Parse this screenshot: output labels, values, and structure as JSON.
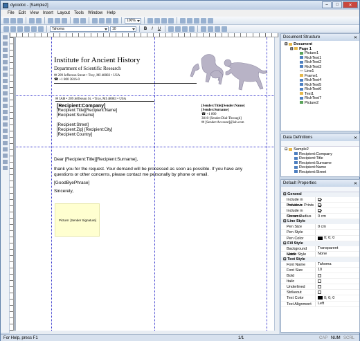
{
  "window": {
    "title": "dycodoc - [Sample2]",
    "close_label": "✕",
    "min_label": "–",
    "max_label": "□"
  },
  "menu": [
    "File",
    "Edit",
    "View",
    "Insert",
    "Layout",
    "Tools",
    "Window",
    "Help"
  ],
  "toolbar": {
    "zoom": "100%",
    "font_name": "Tahoma",
    "font_size": "10",
    "bold": "B",
    "italic": "I",
    "underline": "U"
  },
  "document": {
    "institute_title": "Institute for Ancient History",
    "department": "Department of Scientific Research",
    "address": "209 Jefferson Street • Troy, MI 48083 • USA",
    "phone": "+1 800 3816-0",
    "sender_line": "IAH • 209 Jefferson St. • Troy, MI 48083 • USA",
    "recipient": {
      "company": "[Recipient:Company]",
      "title_name": "[Recipient:Title][Recipient:Name]",
      "surname": "[Recipient:Surname]",
      "street": "[Recipient:Street]",
      "zip_city": "[Recipient:Zip] [Recipient:City]",
      "country": "[Recipient:Country]"
    },
    "sender": {
      "title_name": "[Sender:Title][Sender:Name]",
      "surname": "[Sender:Surname]",
      "phone": "+1 800",
      "dial": "3816-[Sender:Dial-Through]",
      "email": "[Sender:Account]@iah.com"
    },
    "salutation": "Dear [Recipient:Title][Recipient:Surname],",
    "paragraph": "thank you for the request. Your demand will be processed as soon as possible. If you have any questions or other concerns, please contact me personally by phone or email.",
    "goodbye": "[GoodByePhrase]",
    "sincerely": "Sincerely,",
    "signature": "Picture: [Sender Signature]"
  },
  "structure_panel": {
    "title": "Document Structure",
    "root": "Document",
    "page": "Page 1",
    "items": [
      "Picture1",
      "RichText1",
      "RichText2",
      "RichText3",
      "Line1",
      "Frame1",
      "RichText4",
      "RichText5",
      "RichText6",
      "Text1",
      "RichText7",
      "Picture2"
    ],
    "item_types": [
      "pic",
      "rt",
      "rt",
      "rt",
      "ln",
      "fr",
      "rt",
      "rt",
      "rt",
      "tx",
      "rt",
      "pic"
    ]
  },
  "data_panel": {
    "title": "Data Definitions",
    "root": "Sample2",
    "items": [
      "Recipient:Company",
      "Recipient:Title",
      "Recipient:Surname",
      "Recipient:Name",
      "Recipient:Street"
    ]
  },
  "props_panel": {
    "title": "Default Properties",
    "general": {
      "label": "General",
      "rows": [
        {
          "name": "Include in Previews",
          "value": "",
          "check": true
        },
        {
          "name": "Include in Prints",
          "value": "",
          "check": true
        },
        {
          "name": "Include in Streams",
          "value": "",
          "check": true
        },
        {
          "name": "Corner Radius",
          "value": "0 cm"
        }
      ]
    },
    "line": {
      "label": "Line Style",
      "rows": [
        {
          "name": "Pen Size",
          "value": "0 cm"
        },
        {
          "name": "Pen Style",
          "value": ""
        },
        {
          "name": "Pen Color",
          "value": "0; 0; 0",
          "swatch": "#000000"
        }
      ]
    },
    "fill": {
      "label": "Fill Style",
      "rows": [
        {
          "name": "Background Mode",
          "value": "Transparent"
        },
        {
          "name": "Hatch Style",
          "value": "None"
        }
      ]
    },
    "text": {
      "label": "Text Style",
      "rows": [
        {
          "name": "Font Name",
          "value": "Tahoma"
        },
        {
          "name": "Font Size",
          "value": "10"
        },
        {
          "name": "Bold",
          "value": "",
          "check": false
        },
        {
          "name": "Italic",
          "value": "",
          "check": false
        },
        {
          "name": "Underlined",
          "value": "",
          "check": false
        },
        {
          "name": "Strikeout",
          "value": "",
          "check": false
        },
        {
          "name": "Text Color",
          "value": "0; 0; 0",
          "swatch": "#000000"
        },
        {
          "name": "Text Alignment",
          "value": "Left"
        }
      ]
    }
  },
  "status": {
    "help": "For Help, press F1",
    "page": "1/1",
    "cap": "CAP",
    "num": "NUM",
    "scrl": "SCRL"
  }
}
